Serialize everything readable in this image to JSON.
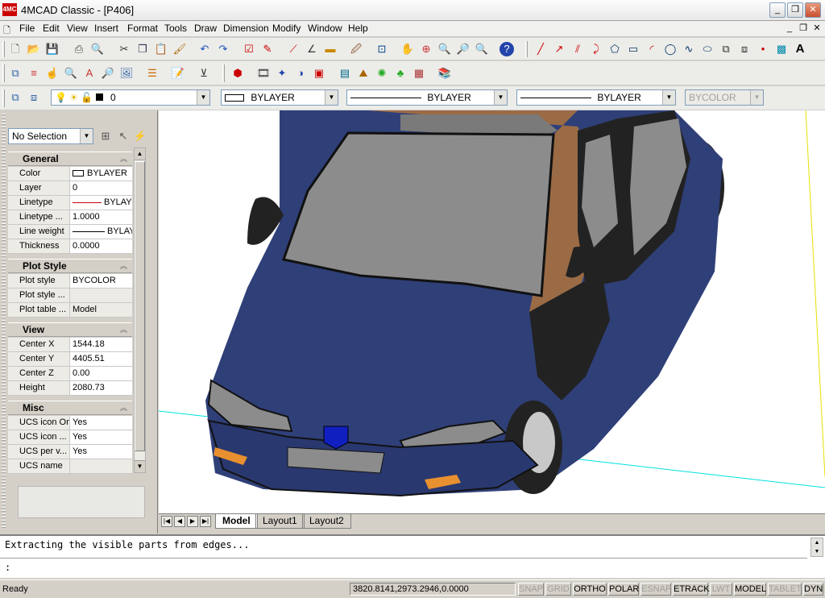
{
  "window": {
    "logo_text": "4MC",
    "title": "4MCAD Classic  - [P406]",
    "min_glyph": "_",
    "max_glyph": "❐",
    "close_glyph": "✕"
  },
  "menu": [
    "File",
    "Edit",
    "View",
    "Insert",
    "Format",
    "Tools",
    "Draw",
    "Dimension",
    "Modify",
    "Window",
    "Help"
  ],
  "layers_toolbar": {
    "layer_value": "0",
    "color_value": "BYLAYER",
    "linetype_value": "BYLAYER",
    "lineweight_value": "BYLAYER",
    "plotstyle_value": "BYCOLOR"
  },
  "properties": {
    "selection": "No Selection",
    "sections": [
      {
        "title": "General",
        "rows": [
          {
            "label": "Color",
            "value": "BYLAYER"
          },
          {
            "label": "Layer",
            "value": "0"
          },
          {
            "label": "Linetype",
            "value": "BYLAYER"
          },
          {
            "label": "Linetype ...",
            "value": "1.0000"
          },
          {
            "label": "Line weight",
            "value": "BYLAYER"
          },
          {
            "label": "Thickness",
            "value": "0.0000"
          }
        ]
      },
      {
        "title": "Plot Style",
        "rows": [
          {
            "label": "Plot style",
            "value": "BYCOLOR"
          },
          {
            "label": "Plot style ...",
            "value": ""
          },
          {
            "label": "Plot table ...",
            "value": "Model"
          }
        ]
      },
      {
        "title": "View",
        "rows": [
          {
            "label": "Center X",
            "value": "1544.18"
          },
          {
            "label": "Center Y",
            "value": "4405.51"
          },
          {
            "label": "Center Z",
            "value": "0.00"
          },
          {
            "label": "Height",
            "value": "2080.73"
          }
        ]
      },
      {
        "title": "Misc",
        "rows": [
          {
            "label": "UCS icon On",
            "value": "Yes"
          },
          {
            "label": "UCS icon ...",
            "value": "Yes"
          },
          {
            "label": "UCS per v...",
            "value": "Yes"
          },
          {
            "label": "UCS name",
            "value": ""
          }
        ]
      }
    ]
  },
  "tabs": [
    "Model",
    "Layout1",
    "Layout2"
  ],
  "command": {
    "history": "Extracting the visible parts from edges...",
    "prompt": ":"
  },
  "status": {
    "ready": "Ready",
    "coords": "3820.8141,2973.2946,0.0000",
    "buttons": [
      {
        "label": "SNAP",
        "on": false
      },
      {
        "label": "GRID",
        "on": false
      },
      {
        "label": "ORTHO",
        "on": true
      },
      {
        "label": "POLAR",
        "on": true
      },
      {
        "label": "ESNAP",
        "on": false
      },
      {
        "label": "ETRACK",
        "on": true
      },
      {
        "label": "LWT",
        "on": false
      },
      {
        "label": "MODEL",
        "on": true
      },
      {
        "label": "TABLET",
        "on": false
      },
      {
        "label": "DYN",
        "on": true
      }
    ]
  },
  "colors": {
    "car_body": "#2f3f78",
    "car_glass": "#8c8c8c",
    "car_trim": "#9a6b45",
    "tire": "#222222",
    "ucs_cyan": "#00e0e0",
    "ucs_yellow": "#e8e000"
  },
  "icons": {
    "std": [
      "new-icon",
      "open-icon",
      "save-icon",
      "print-icon",
      "preview-icon",
      "cut-icon",
      "copy-icon",
      "paste-icon",
      "matchprop-icon",
      "undo-icon",
      "redo-icon",
      "properties-icon",
      "check-icon",
      "snap-icon",
      "angle-icon",
      "ruler-icon",
      "brush-icon",
      "zoom-window-icon",
      "pan-icon",
      "zoom-icon",
      "zoom-prev-icon",
      "zoom-ext-icon",
      "help-icon"
    ],
    "draw": [
      "line-icon",
      "ray-icon",
      "mline-icon",
      "pline-icon",
      "polygon-icon",
      "rect-icon",
      "arc-icon",
      "circle-icon",
      "spline-icon",
      "ellipse-icon",
      "block-icon",
      "insert-icon",
      "point-icon",
      "hatch-icon",
      "text-icon"
    ]
  }
}
